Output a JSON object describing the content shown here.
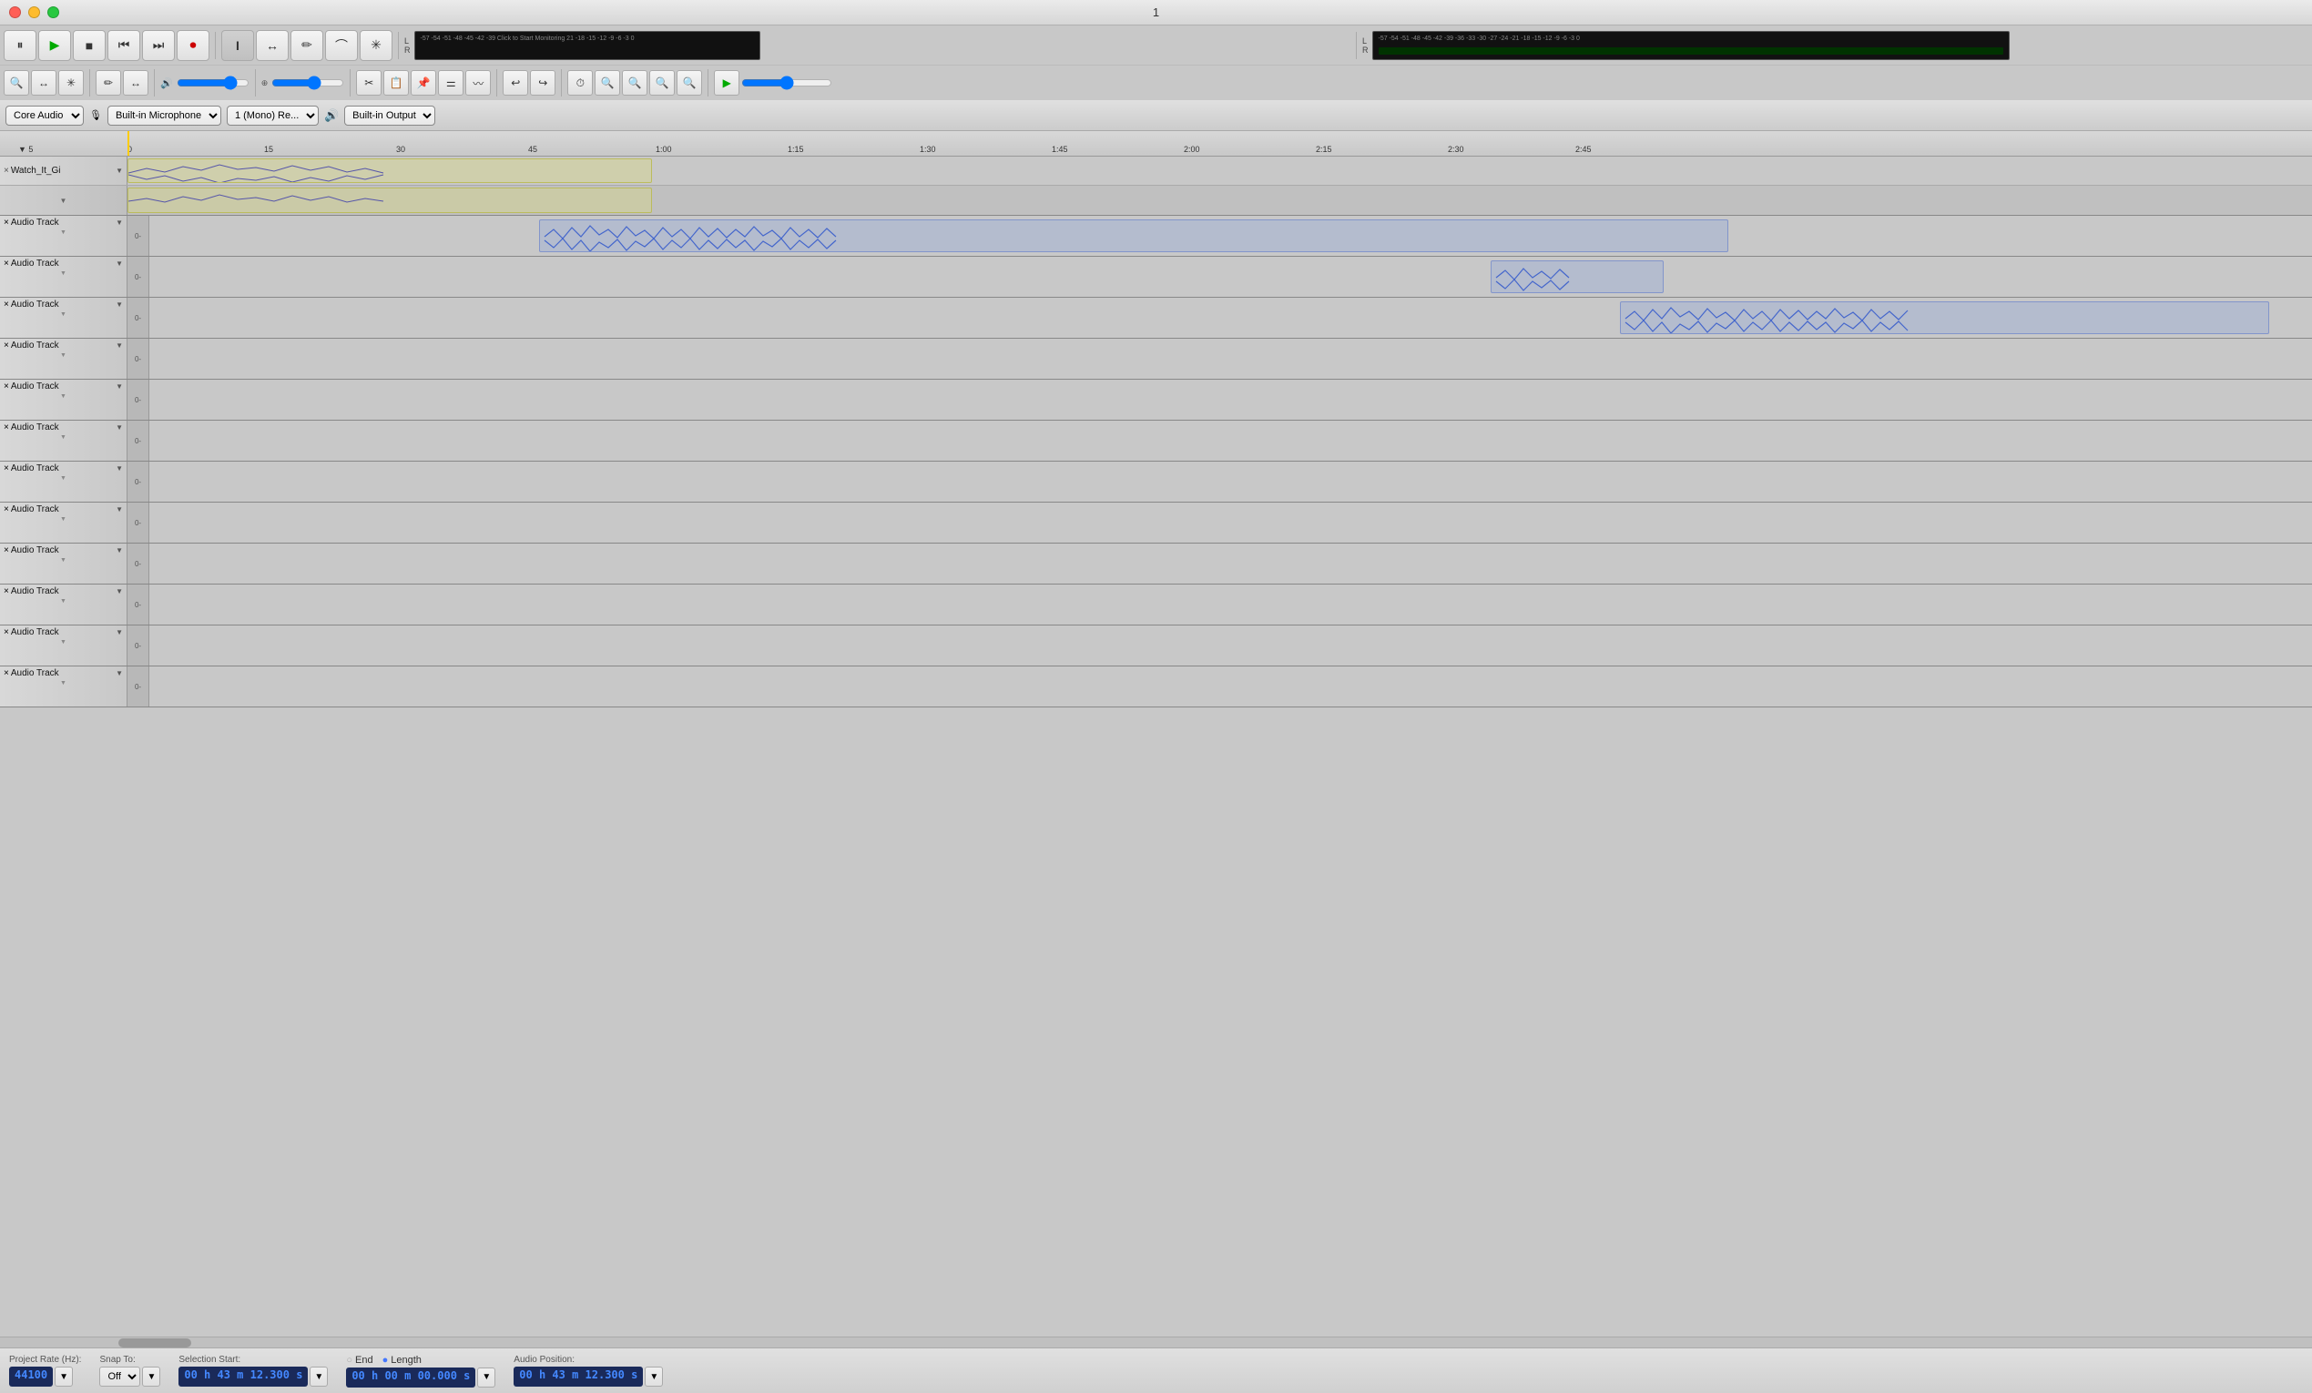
{
  "window": {
    "title": "1",
    "close": "×",
    "minimize": "−",
    "maximize": "+"
  },
  "toolbar": {
    "pause_label": "⏸",
    "play_label": "▶",
    "stop_label": "■",
    "skip_start_label": "⏮",
    "skip_end_label": "⏭",
    "record_label": "⏺",
    "tool_select": "I",
    "tool_zoom": "↔",
    "tool_draw": "✏",
    "tool_envelope": "∿",
    "tool_multi": "✳",
    "snap_to_label": "Snap To:",
    "snap_off": "Off"
  },
  "device_bar": {
    "audio_host": "Core Audio",
    "mic_label": "Built-in Microphone",
    "channel_label": "1 (Mono) Re...",
    "speaker_label": "Built-in Output"
  },
  "ruler": {
    "ticks": [
      "5",
      "0",
      "15",
      "30",
      "45",
      "1:00",
      "1:15",
      "1:30",
      "1:45",
      "2:00",
      "2:15",
      "2:30",
      "2:45"
    ]
  },
  "tracks": [
    {
      "id": "watch-it",
      "name": "Watch_It_Gi",
      "type": "stereo",
      "has_clip": true,
      "clip_start_pct": 0,
      "clip_width_pct": 24,
      "clip_color": "yellow"
    },
    {
      "id": "audio-1",
      "name": "Audio Track",
      "has_clip": true,
      "clip_start_pct": 18,
      "clip_width_pct": 55,
      "clip_color": "blue"
    },
    {
      "id": "audio-2",
      "name": "Audio Track",
      "has_clip": true,
      "clip_start_pct": 62,
      "clip_width_pct": 8,
      "clip_color": "blue"
    },
    {
      "id": "audio-3",
      "name": "Audio Track",
      "has_clip": true,
      "clip_start_pct": 68,
      "clip_width_pct": 30,
      "clip_color": "blue"
    },
    {
      "id": "audio-4",
      "name": "Audio Track",
      "has_clip": false
    },
    {
      "id": "audio-5",
      "name": "Audio Track",
      "has_clip": false
    },
    {
      "id": "audio-6",
      "name": "Audio Track",
      "has_clip": false
    },
    {
      "id": "audio-7",
      "name": "Audio Track",
      "has_clip": false
    },
    {
      "id": "audio-8",
      "name": "Audio Track",
      "has_clip": false
    },
    {
      "id": "audio-9",
      "name": "Audio Track",
      "has_clip": false
    },
    {
      "id": "audio-10",
      "name": "Audio Track",
      "has_clip": false
    },
    {
      "id": "audio-11",
      "name": "Audio Track",
      "has_clip": false
    },
    {
      "id": "audio-12",
      "name": "Audio Track",
      "has_clip": false
    }
  ],
  "status_bar": {
    "project_rate_label": "Project Rate (Hz):",
    "project_rate_value": "44100",
    "snap_to_label": "Snap To:",
    "snap_off": "Off",
    "selection_start_label": "Selection Start:",
    "end_label": "End",
    "length_label": "Length",
    "selection_start_value": "00 h 43 m 12.300 s",
    "selection_end_value": "00 h 00 m 00.000 s",
    "audio_position_label": "Audio Position:",
    "audio_position_value": "00 h 43 m 12.300 s"
  },
  "meter_left": {
    "scale": "-57 -54 -51 -48 -45 -42 -39",
    "label": "L R"
  },
  "meter_right": {
    "scale": "-57 -54 -51 -48 -45 -42 -39 -36 -33 -30 -27 -24 -21 -18 -15 -12 -9 -6 -3 0",
    "label": "L R"
  },
  "icons": {
    "close": "×",
    "dropdown": "▼",
    "sub_dropdown": "▼",
    "radio_filled": "●",
    "radio_empty": "○",
    "volume": "🔊",
    "mic": "🎙",
    "zoom_in": "🔍",
    "zoom_out": "🔎"
  }
}
